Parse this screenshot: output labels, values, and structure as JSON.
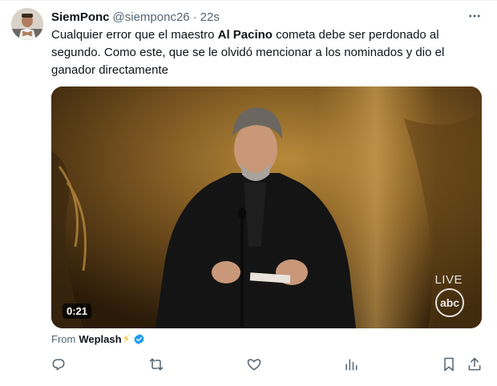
{
  "tweet": {
    "author_name": "SiemPonc",
    "handle": "@siemponc26",
    "separator": "·",
    "time": "22s",
    "text_before": "Cualquier error que el maestro ",
    "text_bold": "Al Pacino",
    "text_after": " cometa debe ser perdonado al segundo. Como este, que se le olvidó mencionar a los nominados y dio el ganador directamente"
  },
  "media": {
    "duration": "0:21",
    "live_label": "LIVE",
    "network_logo": "abc"
  },
  "source": {
    "from_label": "From",
    "app_name": "Weplash",
    "bolt": "⚡"
  },
  "icons": {
    "more": "more-dots-icon",
    "reply": "reply-icon",
    "retweet": "retweet-icon",
    "like": "like-icon",
    "views": "views-icon",
    "bookmark": "bookmark-icon",
    "share": "share-icon",
    "verified": "verified-badge-icon"
  },
  "colors": {
    "text_primary": "#0f1419",
    "text_secondary": "#536471",
    "verified_blue": "#1d9bf0"
  }
}
